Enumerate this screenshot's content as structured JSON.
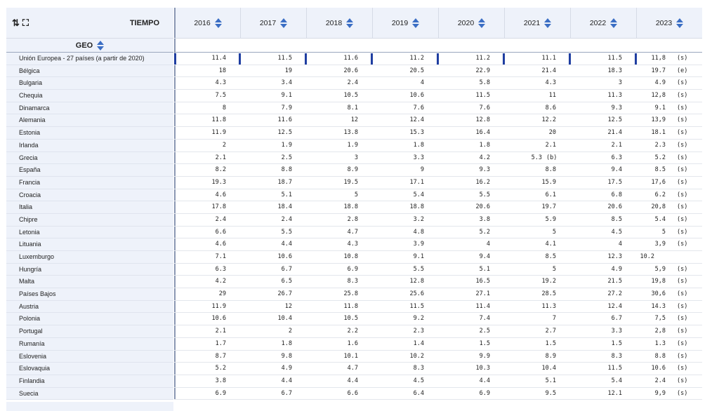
{
  "header": {
    "sort_icon": "sort-arrows-icon",
    "expand_icon": "expand-icon",
    "time_label": "TIEMPO",
    "geo_label": "GEO",
    "colors": {
      "header_bg": "#eef2fa",
      "accent": "#1f3ea1",
      "sort_arrow": "#3b6ec4"
    }
  },
  "years": [
    "2016",
    "2017",
    "2018",
    "2019",
    "2020",
    "2021",
    "2022",
    "2023"
  ],
  "rows": [
    {
      "geo": "Unión Europea - 27 países (a partir de 2020)",
      "values": [
        "11.4",
        "11.5",
        "11.6",
        "11.2",
        "11.2",
        "11.1",
        "11.5",
        "11,8"
      ],
      "flags": [
        "",
        "",
        "",
        "",
        "",
        "",
        "",
        "(s)"
      ]
    },
    {
      "geo": "Bélgica",
      "values": [
        "18",
        "19",
        "20.6",
        "20.5",
        "22.9",
        "21.4",
        "18.3",
        "19.7"
      ],
      "flags": [
        "",
        "",
        "",
        "",
        "",
        "",
        "",
        "(e)"
      ]
    },
    {
      "geo": "Bulgaria",
      "values": [
        "4.3",
        "3.4",
        "2.4",
        "4",
        "5.8",
        "4.3",
        "3",
        "4.9"
      ],
      "flags": [
        "",
        "",
        "",
        "",
        "",
        "",
        "",
        "(s)"
      ]
    },
    {
      "geo": "Chequia",
      "values": [
        "7.5",
        "9.1",
        "10.5",
        "10.6",
        "11.5",
        "11",
        "11.3",
        "12,8"
      ],
      "flags": [
        "",
        "",
        "",
        "",
        "",
        "",
        "",
        "(s)"
      ]
    },
    {
      "geo": "Dinamarca",
      "values": [
        "8",
        "7.9",
        "8.1",
        "7.6",
        "7.6",
        "8.6",
        "9.3",
        "9.1"
      ],
      "flags": [
        "",
        "",
        "",
        "",
        "",
        "",
        "",
        "(s)"
      ]
    },
    {
      "geo": "Alemania",
      "values": [
        "11.8",
        "11.6",
        "12",
        "12.4",
        "12.8",
        "12.2",
        "12.5",
        "13,9"
      ],
      "flags": [
        "",
        "",
        "",
        "",
        "",
        "",
        "",
        "(s)"
      ]
    },
    {
      "geo": "Estonia",
      "values": [
        "11.9",
        "12.5",
        "13.8",
        "15.3",
        "16.4",
        "20",
        "21.4",
        "18.1"
      ],
      "flags": [
        "",
        "",
        "",
        "",
        "",
        "",
        "",
        "(s)"
      ]
    },
    {
      "geo": "Irlanda",
      "values": [
        "2",
        "1.9",
        "1.9",
        "1.8",
        "1.8",
        "2.1",
        "2.1",
        "2.3"
      ],
      "flags": [
        "",
        "",
        "",
        "",
        "",
        "",
        "",
        "(s)"
      ]
    },
    {
      "geo": "Grecia",
      "values": [
        "2.1",
        "2.5",
        "3",
        "3.3",
        "4.2",
        "5.3",
        "6.3",
        "5.2"
      ],
      "flags": [
        "",
        "",
        "",
        "",
        "",
        "(b)",
        "",
        "(s)"
      ]
    },
    {
      "geo": "España",
      "values": [
        "8.2",
        "8.8",
        "8.9",
        "9",
        "9.3",
        "8.8",
        "9.4",
        "8.5"
      ],
      "flags": [
        "",
        "",
        "",
        "",
        "",
        "",
        "",
        "(s)"
      ]
    },
    {
      "geo": "Francia",
      "values": [
        "19.3",
        "18.7",
        "19.5",
        "17.1",
        "16.2",
        "15.9",
        "17.5",
        "17,6"
      ],
      "flags": [
        "",
        "",
        "",
        "",
        "",
        "",
        "",
        "(s)"
      ]
    },
    {
      "geo": "Croacia",
      "values": [
        "4.6",
        "5.1",
        "5",
        "5.4",
        "5.5",
        "6.1",
        "6.8",
        "6.2"
      ],
      "flags": [
        "",
        "",
        "",
        "",
        "",
        "",
        "",
        "(s)"
      ]
    },
    {
      "geo": "Italia",
      "values": [
        "17.8",
        "18.4",
        "18.8",
        "18.8",
        "20.6",
        "19.7",
        "20.6",
        "20,8"
      ],
      "flags": [
        "",
        "",
        "",
        "",
        "",
        "",
        "",
        "(s)"
      ]
    },
    {
      "geo": "Chipre",
      "values": [
        "2.4",
        "2.4",
        "2.8",
        "3.2",
        "3.8",
        "5.9",
        "8.5",
        "5.4"
      ],
      "flags": [
        "",
        "",
        "",
        "",
        "",
        "",
        "",
        "(s)"
      ]
    },
    {
      "geo": "Letonia",
      "values": [
        "6.6",
        "5.5",
        "4.7",
        "4.8",
        "5.2",
        "5",
        "4.5",
        "5"
      ],
      "flags": [
        "",
        "",
        "",
        "",
        "",
        "",
        "",
        "(s)"
      ]
    },
    {
      "geo": "Lituania",
      "values": [
        "4.6",
        "4.4",
        "4.3",
        "3.9",
        "4",
        "4.1",
        "4",
        "3,9"
      ],
      "flags": [
        "",
        "",
        "",
        "",
        "",
        "",
        "",
        "(s)"
      ]
    },
    {
      "geo": "Luxemburgo",
      "values": [
        "7.1",
        "10.6",
        "10.8",
        "9.1",
        "9.4",
        "8.5",
        "12.3",
        "10.2"
      ],
      "flags": [
        "",
        "",
        "",
        "",
        "",
        "",
        "",
        ""
      ]
    },
    {
      "geo": "Hungría",
      "values": [
        "6.3",
        "6.7",
        "6.9",
        "5.5",
        "5.1",
        "5",
        "4.9",
        "5,9"
      ],
      "flags": [
        "",
        "",
        "",
        "",
        "",
        "",
        "",
        "(s)"
      ]
    },
    {
      "geo": "Malta",
      "values": [
        "4.2",
        "6.5",
        "8.3",
        "12.8",
        "16.5",
        "19.2",
        "21.5",
        "19,8"
      ],
      "flags": [
        "",
        "",
        "",
        "",
        "",
        "",
        "",
        "(s)"
      ]
    },
    {
      "geo": "Países Bajos",
      "values": [
        "29",
        "26.7",
        "25.8",
        "25.6",
        "27.1",
        "28.5",
        "27.2",
        "30,6"
      ],
      "flags": [
        "",
        "",
        "",
        "",
        "",
        "",
        "",
        "(s)"
      ]
    },
    {
      "geo": "Austria",
      "values": [
        "11.9",
        "12",
        "11.8",
        "11.5",
        "11.4",
        "11.3",
        "12.4",
        "14.3"
      ],
      "flags": [
        "",
        "",
        "",
        "",
        "",
        "",
        "",
        "(s)"
      ]
    },
    {
      "geo": "Polonia",
      "values": [
        "10.6",
        "10.4",
        "10.5",
        "9.2",
        "7.4",
        "7",
        "6.7",
        "7,5"
      ],
      "flags": [
        "",
        "",
        "",
        "",
        "",
        "",
        "",
        "(s)"
      ]
    },
    {
      "geo": "Portugal",
      "values": [
        "2.1",
        "2",
        "2.2",
        "2.3",
        "2.5",
        "2.7",
        "3.3",
        "2,8"
      ],
      "flags": [
        "",
        "",
        "",
        "",
        "",
        "",
        "",
        "(s)"
      ]
    },
    {
      "geo": "Rumanía",
      "values": [
        "1.7",
        "1.8",
        "1.6",
        "1.4",
        "1.5",
        "1.5",
        "1.5",
        "1.3"
      ],
      "flags": [
        "",
        "",
        "",
        "",
        "",
        "",
        "",
        "(s)"
      ]
    },
    {
      "geo": "Eslovenia",
      "values": [
        "8.7",
        "9.8",
        "10.1",
        "10.2",
        "9.9",
        "8.9",
        "8.3",
        "8.8"
      ],
      "flags": [
        "",
        "",
        "",
        "",
        "",
        "",
        "",
        "(s)"
      ]
    },
    {
      "geo": "Eslovaquia",
      "values": [
        "5.2",
        "4.9",
        "4.7",
        "8.3",
        "10.3",
        "10.4",
        "11.5",
        "10.6"
      ],
      "flags": [
        "",
        "",
        "",
        "",
        "",
        "",
        "",
        "(s)"
      ]
    },
    {
      "geo": "Finlandia",
      "values": [
        "3.8",
        "4.4",
        "4.4",
        "4.5",
        "4.4",
        "5.1",
        "5.4",
        "2.4"
      ],
      "flags": [
        "",
        "",
        "",
        "",
        "",
        "",
        "",
        "(s)"
      ]
    },
    {
      "geo": "Suecia",
      "values": [
        "6.9",
        "6.7",
        "6.6",
        "6.4",
        "6.9",
        "9.5",
        "12.1",
        "9,9"
      ],
      "flags": [
        "",
        "",
        "",
        "",
        "",
        "",
        "",
        "(s)"
      ]
    }
  ]
}
